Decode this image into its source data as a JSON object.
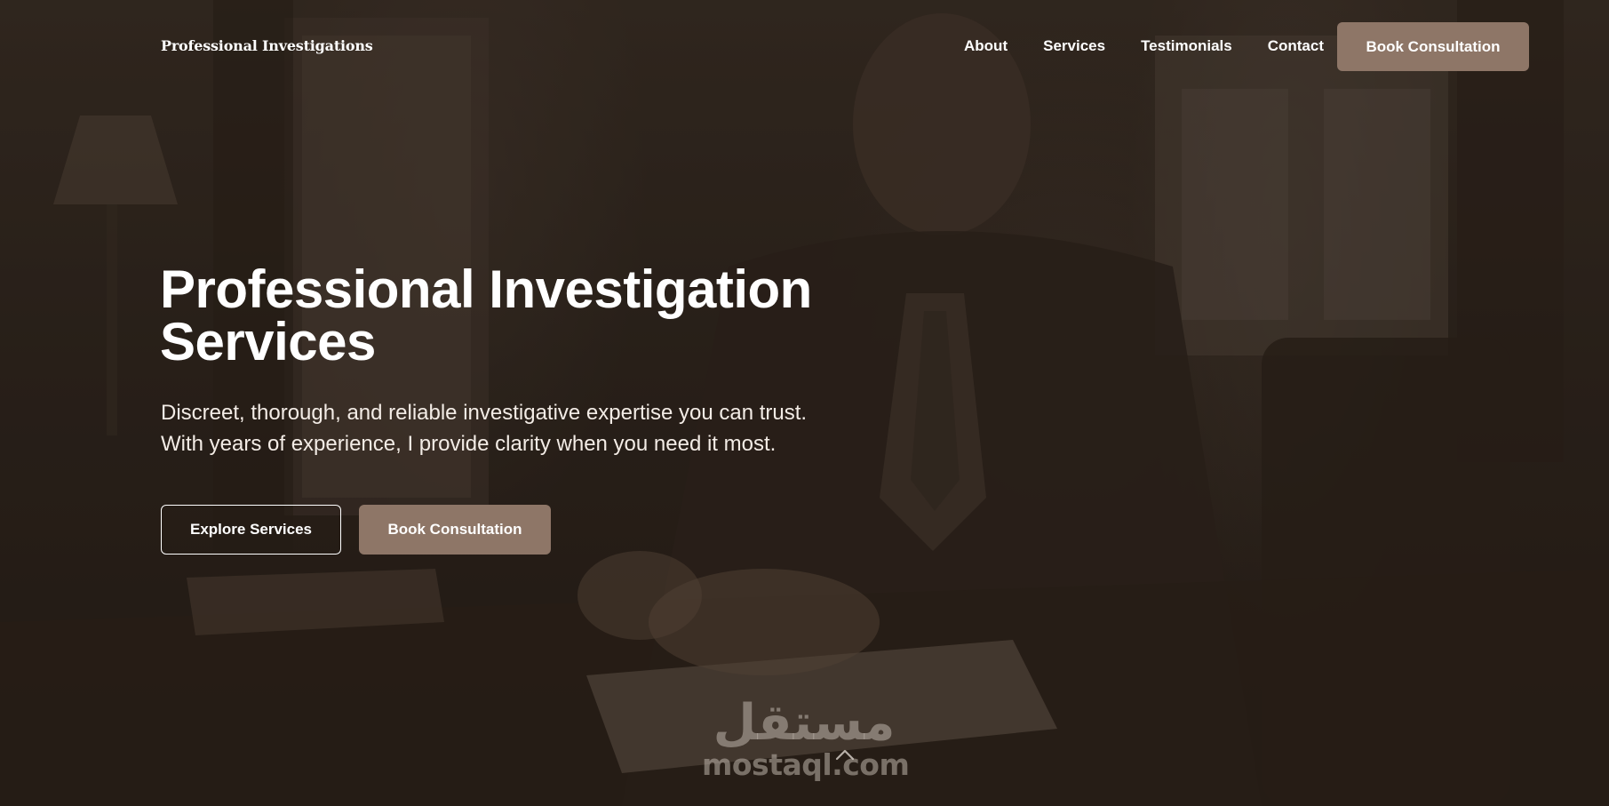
{
  "brand": "Professional Investigations",
  "nav": {
    "links": [
      "About",
      "Services",
      "Testimonials",
      "Contact"
    ],
    "cta_label": "Book Consultation"
  },
  "hero": {
    "headline_line1": "Professional Investigation",
    "headline_line2": "Services",
    "subtext_line1": "Discreet, thorough, and reliable investigative expertise you can trust.",
    "subtext_line2": "With years of experience, I provide clarity when you need it most.",
    "primary_button": "Explore Services",
    "secondary_button": "Book Consultation"
  },
  "watermark": {
    "arabic": "مستقل",
    "latin": "mostaql.com"
  },
  "colors": {
    "accent": "#8e7667",
    "background": "#2a2019",
    "text": "#ffffff"
  },
  "icons": {
    "scroll": "chevron-up-icon"
  }
}
